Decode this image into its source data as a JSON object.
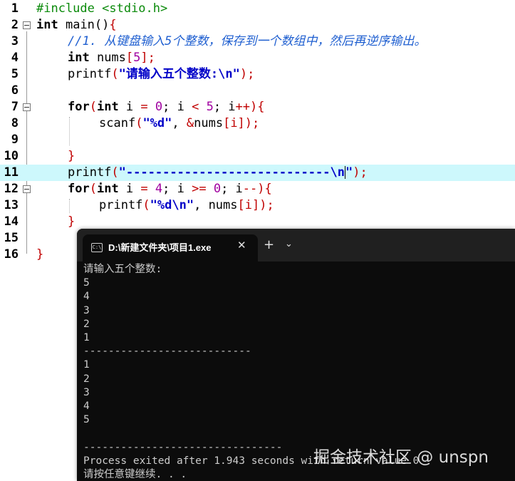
{
  "editor": {
    "lines": [
      {
        "num": "1"
      },
      {
        "num": "2"
      },
      {
        "num": "3"
      },
      {
        "num": "4"
      },
      {
        "num": "5"
      },
      {
        "num": "6"
      },
      {
        "num": "7"
      },
      {
        "num": "8"
      },
      {
        "num": "9"
      },
      {
        "num": "10"
      },
      {
        "num": "11"
      },
      {
        "num": "12"
      },
      {
        "num": "13"
      },
      {
        "num": "14"
      },
      {
        "num": "15"
      },
      {
        "num": "16"
      }
    ],
    "code": {
      "l1_include": "#include <stdio.h>",
      "l2_kw": "int",
      "l2_rest": " main()",
      "l2_brace": "{",
      "l3_comment": "//1. 从键盘输入5个整数，保存到一个数组中，然后再逆序输出。",
      "l4_kw": "int",
      "l4_name": " nums",
      "l4_lb": "[",
      "l4_num": "5",
      "l4_rb": "];",
      "l5_fn": "printf",
      "l5_lp": "(",
      "l5_str": "\"请输入五个整数:\\n\"",
      "l5_rp": ");",
      "l7_for": "for",
      "l7_lp": "(",
      "l7_int": "int",
      "l7_i": " i ",
      "l7_eq": "=",
      "l7_zero": " 0",
      "l7_semi1": "; i ",
      "l7_lt": "<",
      "l7_five": " 5",
      "l7_semi2": "; i",
      "l7_inc": "++",
      "l7_rp": "){",
      "l8_fn": "scanf",
      "l8_lp": "(",
      "l8_str": "\"%d\"",
      "l8_comma": ", ",
      "l8_amp": "&",
      "l8_nums": "nums",
      "l8_idx": "[i]);",
      "l10_brace": "}",
      "l11_fn": "printf",
      "l11_lp": "(",
      "l11_str1": "\"----------------------------\\n",
      "l11_str2": "\"",
      "l11_rp": ");",
      "l12_for": "for",
      "l12_lp": "(",
      "l12_int": "int",
      "l12_i": " i ",
      "l12_eq": "=",
      "l12_four": " 4",
      "l12_semi1": "; i ",
      "l12_ge": ">=",
      "l12_zero": " 0",
      "l12_semi2": "; i",
      "l12_dec": "--",
      "l12_rp": "){",
      "l13_fn": "printf",
      "l13_lp": "(",
      "l13_str": "\"%d\\n\"",
      "l13_comma": ", nums",
      "l13_idx": "[i]);",
      "l14_brace": "}",
      "l16_brace": "}"
    }
  },
  "terminal": {
    "tab_title": "D:\\新建文件夹\\项目1.exe",
    "tab_icon": "C:\\",
    "close_glyph": "✕",
    "new_tab_glyph": "+",
    "dropdown_glyph": "⌄",
    "output": "请输入五个整数:\n5\n4\n3\n2\n1\n---------------------------\n1\n2\n3\n4\n5\n\n--------------------------------\nProcess exited after 1.943 seconds with return value 0\n请按任意键继续. . ."
  },
  "watermark": "掘金技术社区 @ unspn",
  "icons": {
    "fold": "fold-minus-icon",
    "terminal": "terminal-icon"
  }
}
